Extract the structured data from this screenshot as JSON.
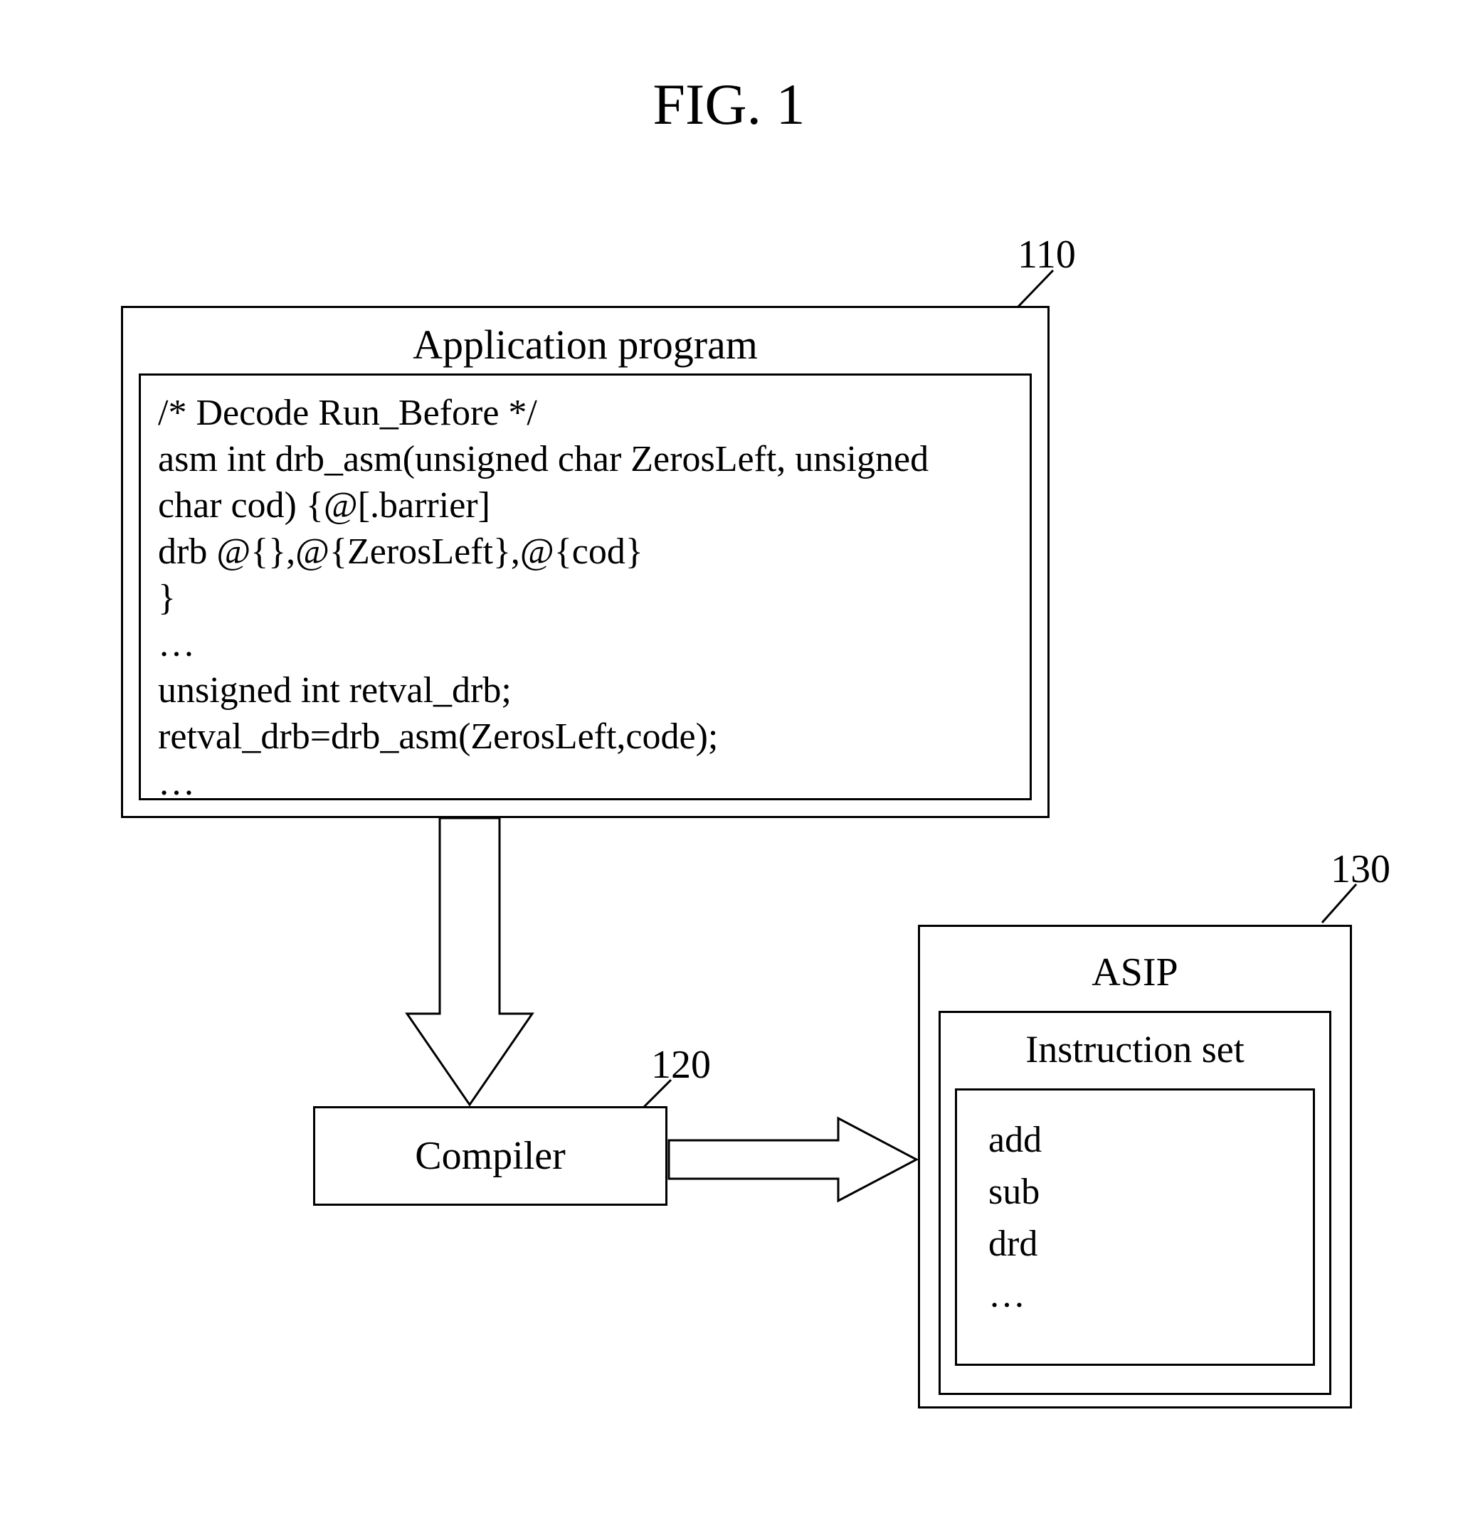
{
  "figure_title": "FIG. 1",
  "refs": {
    "app": "110",
    "compiler": "120",
    "asip": "130"
  },
  "app": {
    "title": "Application program",
    "code": [
      "/* Decode Run_Before */",
      "asm int drb_asm(unsigned char ZerosLeft, unsigned",
      "char cod) {@[.barrier]",
      "drb @{},@{ZerosLeft},@{cod}",
      "}",
      "…",
      "unsigned int retval_drb;",
      "retval_drb=drb_asm(ZerosLeft,code);",
      "…"
    ]
  },
  "compiler": {
    "label": "Compiler"
  },
  "asip": {
    "title": "ASIP",
    "iset_title": "Instruction set",
    "instructions": [
      "add",
      "sub",
      "drd",
      "…"
    ]
  }
}
